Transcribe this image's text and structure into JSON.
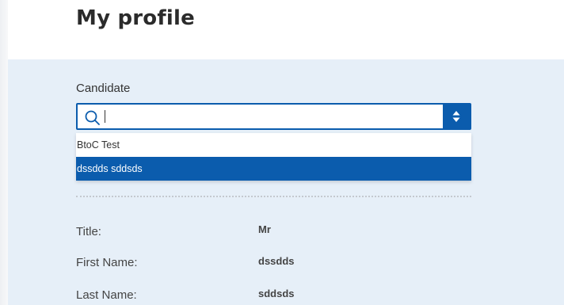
{
  "header": {
    "title": "My profile"
  },
  "candidate": {
    "label": "Candidate",
    "search_value": "",
    "options": [
      {
        "label": "BtoC Test",
        "selected": false
      },
      {
        "label": "dssdds sddsds",
        "selected": true
      }
    ]
  },
  "fields": {
    "title": {
      "label": "Title:",
      "value": "Mr"
    },
    "first_name": {
      "label": "First Name:",
      "value": "dssdds"
    },
    "last_name": {
      "label": "Last Name:",
      "value": "sddsds"
    }
  },
  "colors": {
    "accent": "#0b5cad",
    "panel_background": "#e6eff8"
  },
  "icons": {
    "search": "search-icon",
    "toggle": "sort-arrows-icon"
  }
}
